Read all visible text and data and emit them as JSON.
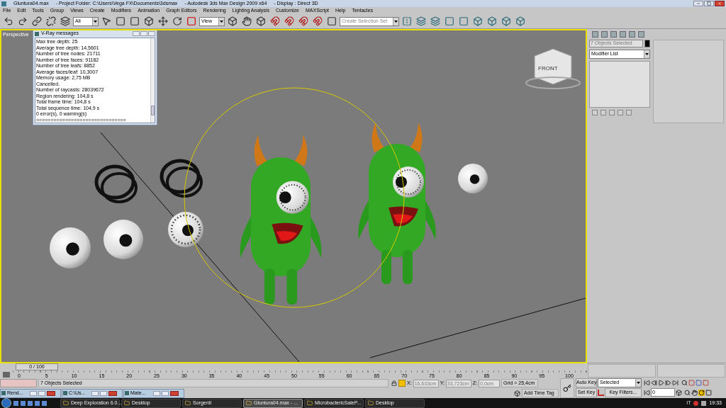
{
  "window": {
    "title_parts": [
      "Giuntura04.max",
      "- Project Folder: C:\\Users\\Vega FX\\Documents\\3dsmax",
      "- Autodesk 3ds Max Design 2009 x64",
      "- Display : Direct 3D"
    ]
  },
  "menu": [
    "File",
    "Edit",
    "Tools",
    "Group",
    "Views",
    "Create",
    "Modifiers",
    "Animation",
    "Graph Editors",
    "Rendering",
    "Lighting Analysis",
    "Customize",
    "MAXScript",
    "Help",
    "Tentacles"
  ],
  "toolbar": {
    "selection_filter": "All",
    "reference_coordinates": "View",
    "named_selection": {
      "placeholder": "Create Selection Set"
    }
  },
  "vray_messages": {
    "title": "V-Ray messages",
    "lines": [
      "Max tree depth: 25",
      "Average tree depth: 14,5601",
      "Number of tree nodes: 21711",
      "Number of tree faces: 91182",
      "Number of tree leafs: 8852",
      "Average faces/leaf: 10,3007",
      "Memory usage: 2,75 MB",
      "Cancelled.",
      "Number of raycasts: 28039672",
      "Region rendering: 104,8 s",
      "Total frame time: 104,8 s",
      "Total sequence time: 104,9 s",
      "0 error(s), 0 warning(s)",
      "==============================="
    ]
  },
  "viewport": {
    "label": "Perspective",
    "viewcube_label": "FRONT"
  },
  "command_panel": {
    "selection_name": "7 Objects Selected",
    "modifier_list": "Modifier List"
  },
  "timeline": {
    "slider": "0 / 100",
    "ticks": [
      "0",
      "5",
      "10",
      "15",
      "20",
      "25",
      "30",
      "35",
      "40",
      "45",
      "50",
      "55",
      "60",
      "65",
      "70",
      "75",
      "80",
      "85",
      "90",
      "95",
      "100"
    ]
  },
  "status": {
    "prompt": "7 Objects Selected",
    "x_label": "X:",
    "x": "16,633cm",
    "y_label": "Y:",
    "y": "33,723cm",
    "z_label": "Z:",
    "z": "0,0cm",
    "grid": "Grid = 25,4cm",
    "time_tag": "Add Time Tag",
    "auto_key": "Auto Key",
    "key_mode": "Selected",
    "set_key": "Set Key",
    "key_filters": "Key Filters...",
    "frame": "0"
  },
  "minimized_windows": [
    {
      "label": "Rend..."
    },
    {
      "label": "C:\\Us..."
    },
    {
      "label": "Mate..."
    }
  ],
  "taskbar": {
    "items": [
      {
        "label": "Deep Exploration 6.0...",
        "selected": false
      },
      {
        "label": "Desktop",
        "selected": false
      },
      {
        "label": "Sorgenti",
        "selected": false
      },
      {
        "label": "Giuntura04.max - ...",
        "selected": true
      },
      {
        "label": "MicrobactericSaleP...",
        "selected": false
      },
      {
        "label": "Desktop",
        "selected": false
      }
    ],
    "language": "IT",
    "clock": "19:33"
  }
}
